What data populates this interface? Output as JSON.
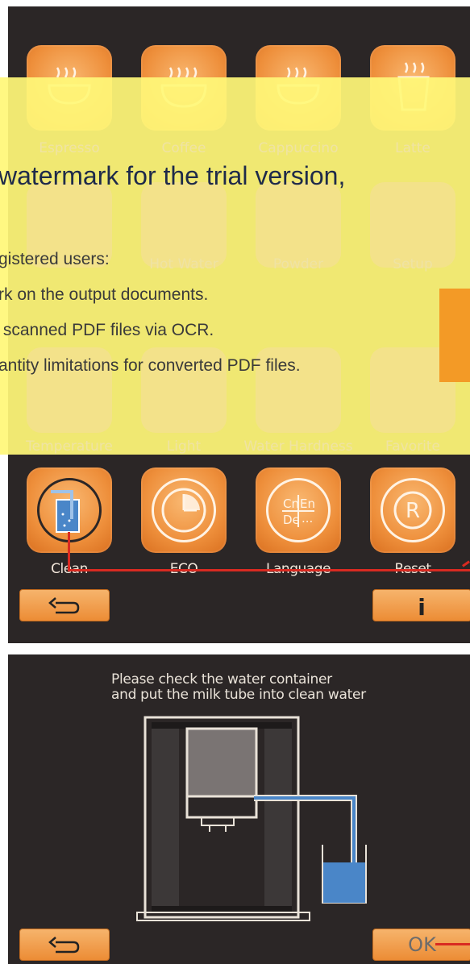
{
  "main_menu": {
    "tiles": [
      {
        "label": "Espresso",
        "icon": "espresso-cup-icon"
      },
      {
        "label": "Coffee",
        "icon": "coffee-cup-icon"
      },
      {
        "label": "Cappuccino",
        "icon": "cappuccino-cup-icon"
      },
      {
        "label": "Latte",
        "icon": "latte-glass-icon"
      },
      {
        "label": "",
        "icon": "hot-water-icon"
      },
      {
        "label": "Hot Water",
        "icon": "hot-water-glass-icon"
      },
      {
        "label": "Powder",
        "icon": "powder-spoon-icon"
      },
      {
        "label": "Setup",
        "icon": "gear-icon"
      },
      {
        "label": "Temperature",
        "icon": "thermometer-icon"
      },
      {
        "label": "Light",
        "icon": "light-icon"
      },
      {
        "label": "Water Hardness",
        "icon": "water-drop-icon"
      },
      {
        "label": "Favorite",
        "icon": "favorite-cup-icon"
      }
    ]
  },
  "watermark": {
    "title": "watermark for the trial version,",
    "lines": [
      "gistered users:",
      "rk on the output documents.",
      " scanned PDF files via OCR.",
      "antity limitations for converted PDF files."
    ]
  },
  "setup_menu": {
    "tiles": [
      {
        "label": "Clean",
        "icon": "clean-glass-icon"
      },
      {
        "label": "ECO",
        "icon": "eco-clock-icon"
      },
      {
        "label": "Language",
        "icon": "language-icon",
        "glyphs": {
          "tl": "Cn",
          "tr": "En",
          "bl": "De",
          "br": "..."
        }
      },
      {
        "label": "Reset",
        "icon": "reset-r-icon",
        "glyph": "R"
      }
    ],
    "info_glyph": "i"
  },
  "clean_screen": {
    "instruction_line1": "Please check the water container",
    "instruction_line2": "and put the milk tube into clean water",
    "ok_label": "OK"
  },
  "colors": {
    "panel": "#2b2626",
    "accent": "#ee8f3b",
    "callout": "#d92a21",
    "tube": "#4a86c8"
  }
}
